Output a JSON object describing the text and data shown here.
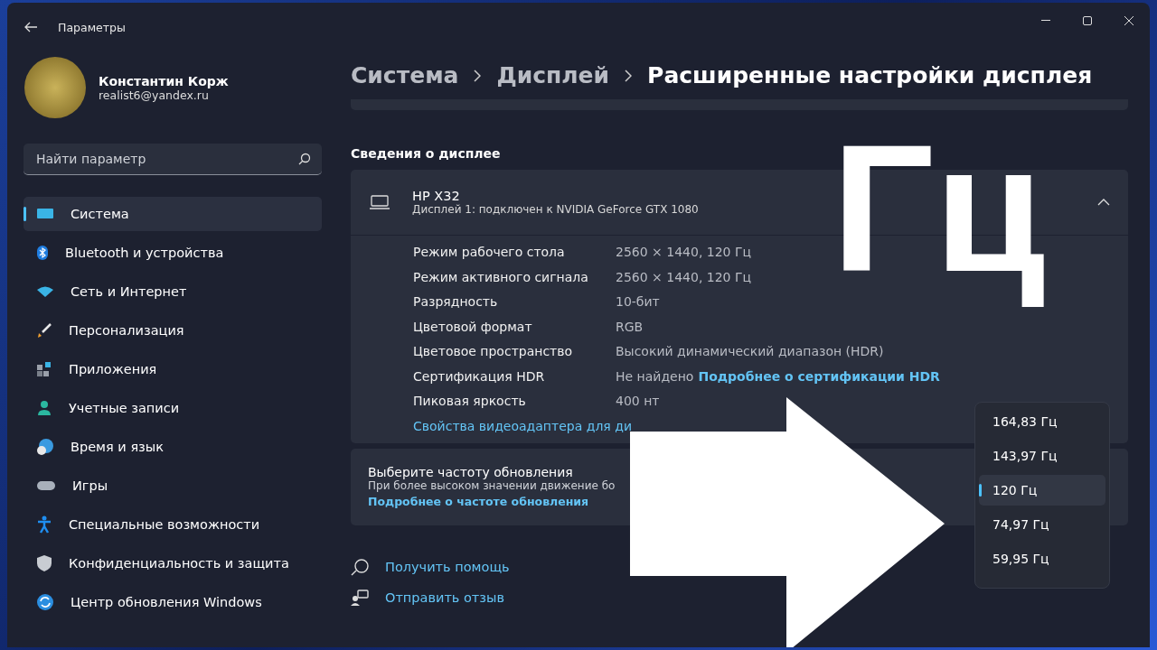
{
  "window": {
    "title": "Параметры"
  },
  "user": {
    "name": "Константин Корж",
    "email": "realist6@yandex.ru"
  },
  "search": {
    "placeholder": "Найти параметр"
  },
  "sidebar": {
    "items": [
      {
        "label": "Система",
        "kind": "system",
        "selected": true
      },
      {
        "label": "Bluetooth и устройства",
        "kind": "bluetooth",
        "selected": false
      },
      {
        "label": "Сеть и Интернет",
        "kind": "network",
        "selected": false
      },
      {
        "label": "Персонализация",
        "kind": "personalization",
        "selected": false
      },
      {
        "label": "Приложения",
        "kind": "apps",
        "selected": false
      },
      {
        "label": "Учетные записи",
        "kind": "accounts",
        "selected": false
      },
      {
        "label": "Время и язык",
        "kind": "time",
        "selected": false
      },
      {
        "label": "Игры",
        "kind": "gaming",
        "selected": false
      },
      {
        "label": "Специальные возможности",
        "kind": "accessibility",
        "selected": false
      },
      {
        "label": "Конфиденциальность и защита",
        "kind": "privacy",
        "selected": false
      },
      {
        "label": "Центр обновления Windows",
        "kind": "update",
        "selected": false
      }
    ]
  },
  "breadcrumb": [
    "Система",
    "Дисплей",
    "Расширенные настройки дисплея"
  ],
  "section_title": "Сведения о дисплее",
  "display": {
    "name": "HP X32",
    "subtitle": "Дисплей 1: подключен к NVIDIA GeForce GTX 1080",
    "expanded": true,
    "rows": [
      {
        "label": "Режим рабочего стола",
        "value": "2560 × 1440, 120 Гц"
      },
      {
        "label": "Режим активного сигнала",
        "value": "2560 × 1440, 120 Гц"
      },
      {
        "label": "Разрядность",
        "value": "10-бит"
      },
      {
        "label": "Цветовой формат",
        "value": "RGB"
      },
      {
        "label": "Цветовое пространство",
        "value": "Высокий динамический диапазон (HDR)"
      },
      {
        "label": "Сертификация HDR",
        "value": "Не найдено",
        "link": "Подробнее о сертификации HDR"
      },
      {
        "label": "Пиковая яркость",
        "value": "400 нт"
      }
    ],
    "adapter_link": "Свойства видеоадаптера для ди"
  },
  "refresh": {
    "title": "Выберите частоту обновления",
    "description": "При более высоком значении движение бо",
    "link": "Подробнее о частоте обновления",
    "options": [
      {
        "label": "164,83 Гц",
        "selected": false
      },
      {
        "label": "143,97 Гц",
        "selected": false
      },
      {
        "label": "120 Гц",
        "selected": true
      },
      {
        "label": "74,97 Гц",
        "selected": false
      },
      {
        "label": "59,95 Гц",
        "selected": false
      }
    ]
  },
  "help_links": [
    {
      "label": "Получить помощь",
      "kind": "help"
    },
    {
      "label": "Отправить отзыв",
      "kind": "feedback"
    }
  ],
  "overlay": {
    "caption": "Гц"
  }
}
